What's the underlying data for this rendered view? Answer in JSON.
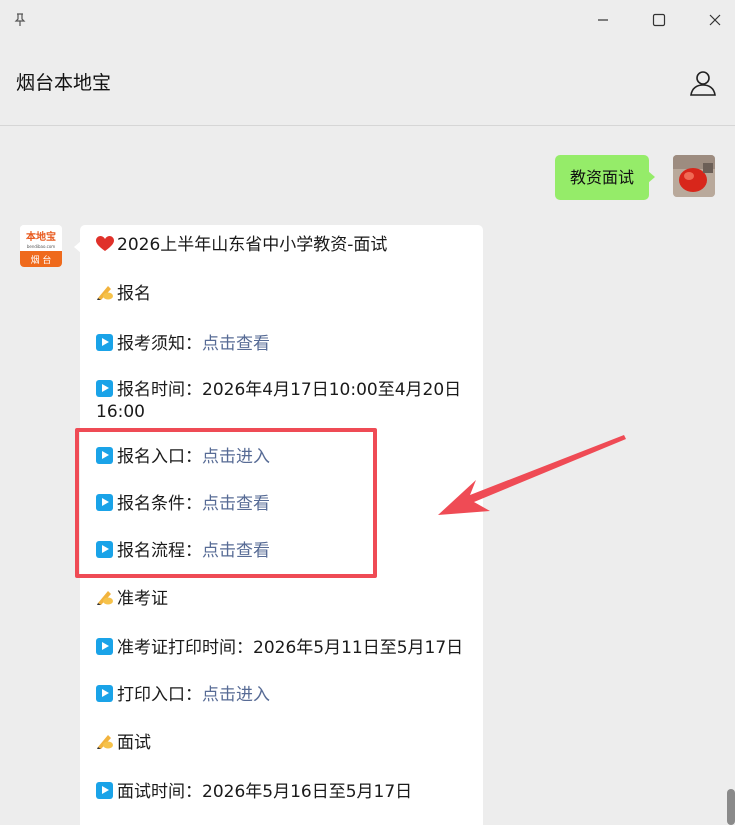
{
  "window": {
    "pin_icon": "pin-icon",
    "minimize_icon": "minimize-icon",
    "maximize_icon": "maximize-icon",
    "close_icon": "close-icon"
  },
  "header": {
    "title": "烟台本地宝",
    "user_icon": "user-profile-icon"
  },
  "chat": {
    "outgoing": {
      "text": "教资面试"
    },
    "bot_avatar": {
      "top_text": "本地宝",
      "sub_text": "bendibao.com",
      "bottom_text": "烟 台"
    },
    "message": {
      "title": "2026上半年山东省中小学教资-面试",
      "sections": {
        "signup": "报名",
        "signup_notice_label": "报考须知：",
        "signup_notice_link": "点击查看",
        "signup_time_label": "报名时间：2026年4月17日10:00至4月20日",
        "signup_time_tail": "16:00",
        "signup_entry_label": "报名入口：",
        "signup_entry_link": "点击进入",
        "signup_cond_label": "报名条件：",
        "signup_cond_link": "点击查看",
        "signup_flow_label": "报名流程：",
        "signup_flow_link": "点击查看",
        "admission": "准考证",
        "admission_time_label": "准考证打印时间：2026年5月11日至5月17日",
        "print_entry_label": "打印入口：",
        "print_entry_link": "点击进入",
        "interview": "面试",
        "interview_time_label": "面试时间：2026年5月16日至5月17日"
      }
    }
  },
  "colors": {
    "background": "#ededed",
    "outgoing_bubble": "#95ec69",
    "link": "#576b95",
    "highlight": "#ef4b55",
    "play_icon": "#1aa3e8"
  }
}
